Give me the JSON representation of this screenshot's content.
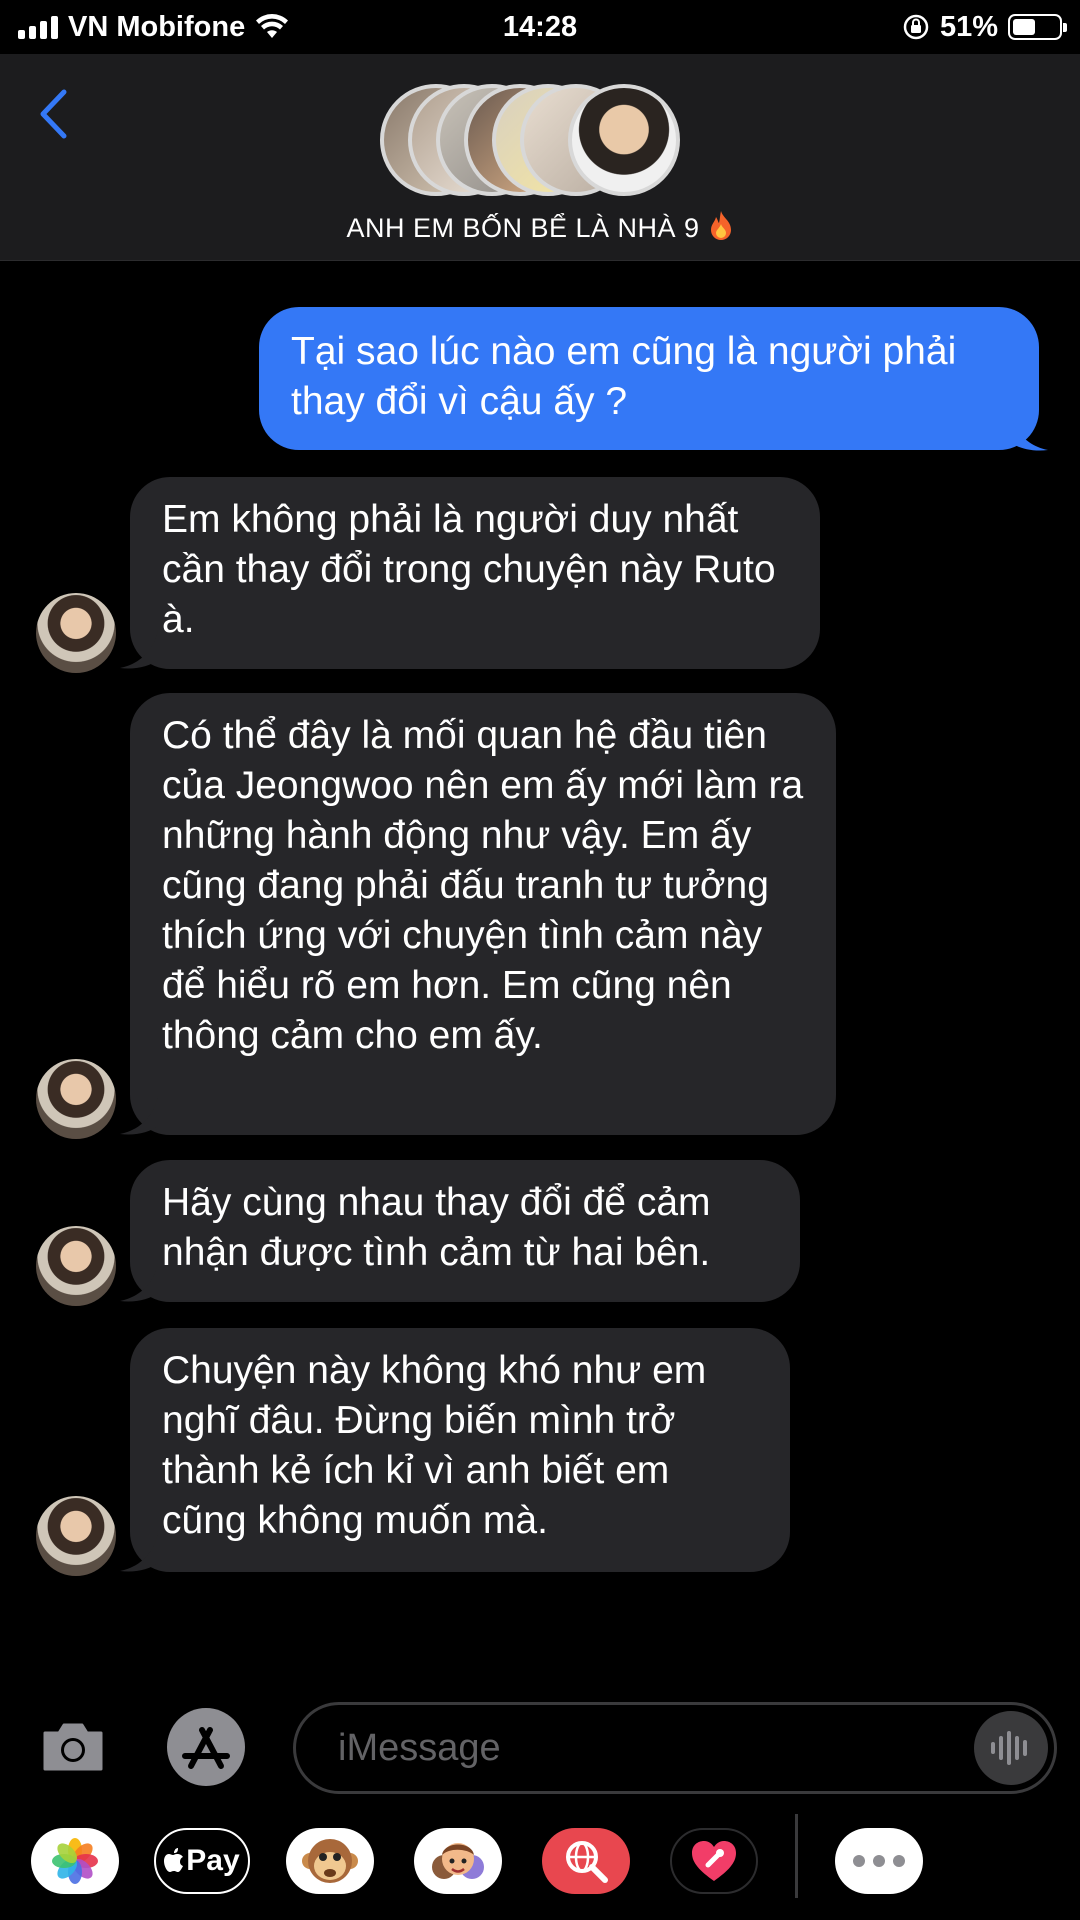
{
  "status_bar": {
    "carrier": "VN Mobifone",
    "time": "14:28",
    "battery_percent": "51%",
    "battery_level": 0.51
  },
  "header": {
    "group_name": "ANH EM BỐN BỂ LÀ NHÀ 9",
    "group_emoji_icon": "fire-icon"
  },
  "messages": [
    {
      "direction": "outgoing",
      "text": "Tại sao lúc nào em cũng là người phải thay đổi vì cậu ấy ?"
    },
    {
      "direction": "incoming",
      "text": "Em không phải là người duy nhất cần thay đổi trong chuyện này Ruto à."
    },
    {
      "direction": "incoming",
      "text": "Có thể đây là mối quan hệ đầu tiên của Jeongwoo nên em ấy mới làm ra những hành động như vậy. Em ấy cũng đang phải đấu tranh tư tưởng thích ứng với chuyện tình cảm này để hiểu rõ em hơn. Em cũng nên thông cảm cho em ấy."
    },
    {
      "direction": "incoming",
      "text": "Hãy cùng nhau thay đổi để cảm nhận được tình cảm từ hai bên."
    },
    {
      "direction": "incoming",
      "text": "Chuyện này không khó như em nghĩ đâu. Đừng biến mình trở thành kẻ ích kỉ vì anh biết em cũng không muốn mà."
    }
  ],
  "input": {
    "placeholder": "iMessage"
  },
  "app_drawer": {
    "apple_pay_label": "Pay",
    "apps": [
      "photos-icon",
      "apple-pay-icon",
      "animoji-icon",
      "memoji-icon",
      "web-search-icon",
      "digital-touch-icon",
      "more-icon"
    ]
  },
  "colors": {
    "outgoing_bubble": "#3478f6",
    "incoming_bubble": "#262629",
    "accent": "#3478f6"
  }
}
